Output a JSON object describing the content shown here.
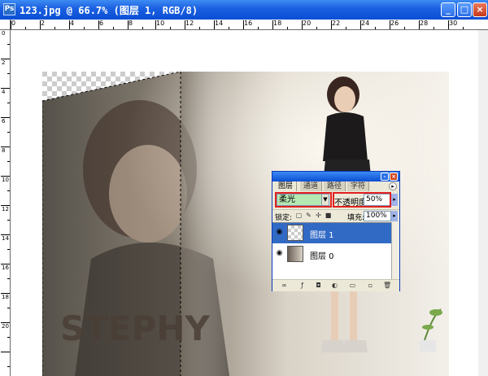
{
  "window": {
    "title": "123.jpg @ 66.7% (图层 1, RGB/8)",
    "app_icon": "ps-icon",
    "minimize_icon": "minimize-icon",
    "maximize_icon": "maximize-icon",
    "close_icon": "close-icon"
  },
  "ruler": {
    "top_numbers": [
      "0",
      "2",
      "4",
      "6",
      "8",
      "10",
      "12",
      "14",
      "16",
      "18",
      "20",
      "22",
      "24",
      "26",
      "28",
      "30"
    ],
    "left_numbers": [
      "0",
      "2",
      "4",
      "6",
      "8",
      "10",
      "12",
      "14",
      "16",
      "18",
      "20"
    ]
  },
  "canvas": {
    "photo_text": "STEPHY"
  },
  "layers_panel": {
    "tabs": [
      "图层",
      "通道",
      "路径",
      "字符"
    ],
    "active_tab": "图层",
    "blend_mode": "柔光",
    "opacity_label": "不透明度:",
    "opacity_value": "50%",
    "lock_label": "锁定:",
    "fill_label": "填充:",
    "fill_value": "100%",
    "layers": [
      {
        "name": "图层 1",
        "selected": true,
        "visible": true
      },
      {
        "name": "图层 0",
        "selected": false,
        "visible": true
      }
    ],
    "highlight_color": "#e02020",
    "selection_color": "#316ac5",
    "blend_field_color": "#b6e8b2"
  }
}
